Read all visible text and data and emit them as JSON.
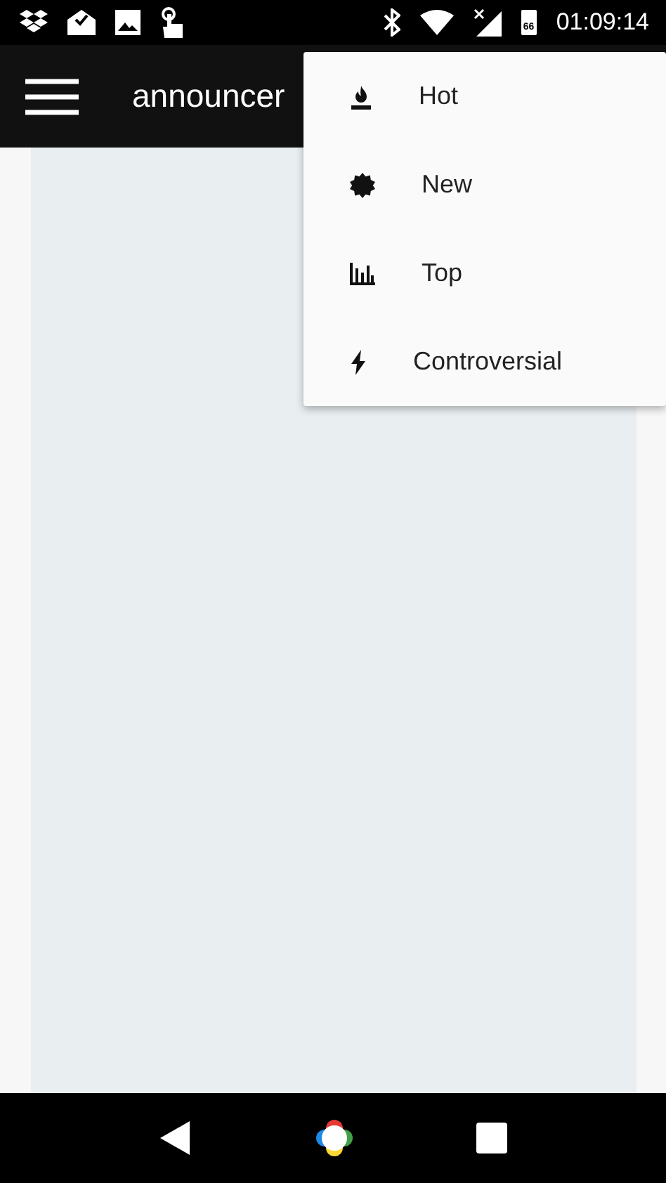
{
  "status_bar": {
    "battery": "66",
    "time": "01:09:14"
  },
  "app_bar": {
    "title": "announcer"
  },
  "sort_menu": [
    {
      "kind": "hot",
      "label": "Hot"
    },
    {
      "kind": "new",
      "label": "New"
    },
    {
      "kind": "top",
      "label": "Top"
    },
    {
      "kind": "controversial",
      "label": "Controversial"
    }
  ]
}
